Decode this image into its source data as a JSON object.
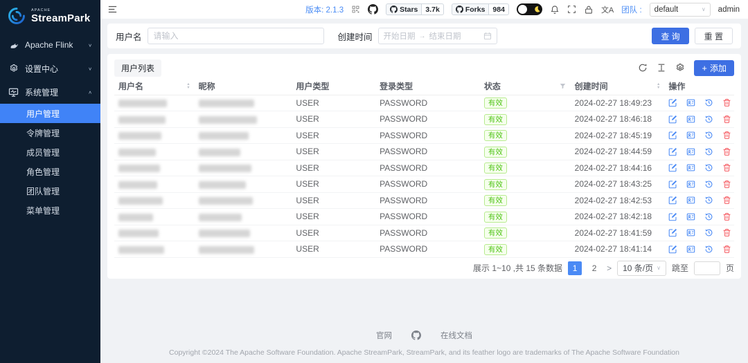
{
  "sidebar": {
    "logo_apache": "APACHE",
    "logo_name": "StreamPark",
    "menu": [
      {
        "label": "Apache Flink"
      },
      {
        "label": "设置中心"
      },
      {
        "label": "系统管理"
      }
    ],
    "submenu": [
      "用户管理",
      "令牌管理",
      "成员管理",
      "角色管理",
      "团队管理",
      "菜单管理"
    ]
  },
  "header": {
    "version": "版本: 2.1.3",
    "stars_label": "Stars",
    "stars_count": "3.7k",
    "forks_label": "Forks",
    "forks_count": "984",
    "translate": "文A",
    "team_label": "团队 :",
    "team_value": "default",
    "user": "admin"
  },
  "filters": {
    "username_label": "用户名",
    "username_placeholder": "请输入",
    "created_label": "创建时间",
    "date_start": "开始日期",
    "date_end": "结束日期",
    "search_button": "查 询",
    "reset_button": "重 置"
  },
  "table": {
    "card_title": "用户列表",
    "add_button": "添加",
    "columns": [
      "用户名",
      "昵称",
      "用户类型",
      "登录类型",
      "状态",
      "创建时间",
      "操作"
    ],
    "rows": [
      {
        "user_type": "USER",
        "login_type": "PASSWORD",
        "status": "有效",
        "created": "2024-02-27 18:49:23",
        "name_w": 70,
        "nick_w": 80
      },
      {
        "user_type": "USER",
        "login_type": "PASSWORD",
        "status": "有效",
        "created": "2024-02-27 18:46:18",
        "name_w": 68,
        "nick_w": 84
      },
      {
        "user_type": "USER",
        "login_type": "PASSWORD",
        "status": "有效",
        "created": "2024-02-27 18:45:19",
        "name_w": 62,
        "nick_w": 72
      },
      {
        "user_type": "USER",
        "login_type": "PASSWORD",
        "status": "有效",
        "created": "2024-02-27 18:44:59",
        "name_w": 54,
        "nick_w": 60
      },
      {
        "user_type": "USER",
        "login_type": "PASSWORD",
        "status": "有效",
        "created": "2024-02-27 18:44:16",
        "name_w": 60,
        "nick_w": 76
      },
      {
        "user_type": "USER",
        "login_type": "PASSWORD",
        "status": "有效",
        "created": "2024-02-27 18:43:25",
        "name_w": 56,
        "nick_w": 68
      },
      {
        "user_type": "USER",
        "login_type": "PASSWORD",
        "status": "有效",
        "created": "2024-02-27 18:42:53",
        "name_w": 64,
        "nick_w": 78
      },
      {
        "user_type": "USER",
        "login_type": "PASSWORD",
        "status": "有效",
        "created": "2024-02-27 18:42:18",
        "name_w": 50,
        "nick_w": 62
      },
      {
        "user_type": "USER",
        "login_type": "PASSWORD",
        "status": "有效",
        "created": "2024-02-27 18:41:59",
        "name_w": 58,
        "nick_w": 74
      },
      {
        "user_type": "USER",
        "login_type": "PASSWORD",
        "status": "有效",
        "created": "2024-02-27 18:41:14",
        "name_w": 66,
        "nick_w": 80
      }
    ]
  },
  "pagination": {
    "summary": "展示 1~10 ,共 15 条数据",
    "page1": "1",
    "page2": "2",
    "next": ">",
    "page_size": "10 条/页",
    "jump_prefix": "跳至",
    "jump_suffix": "页"
  },
  "footer": {
    "site_link": "官网",
    "docs_link": "在线文档",
    "copyright": "Copyright ©2024 The Apache Software Foundation. Apache StreamPark, StreamPark, and its feather logo are trademarks of The Apache Software Foundation"
  },
  "colors": {
    "sidebar_bg": "#0e1e30",
    "sidebar_active": "#4083f7",
    "primary_button": "#3d6fe3",
    "link_blue": "#4a8cf5",
    "status_valid_text": "#52c41a",
    "status_valid_bg": "#f6ffed",
    "danger": "#f5575e",
    "content_bg": "#f0f2f5"
  }
}
